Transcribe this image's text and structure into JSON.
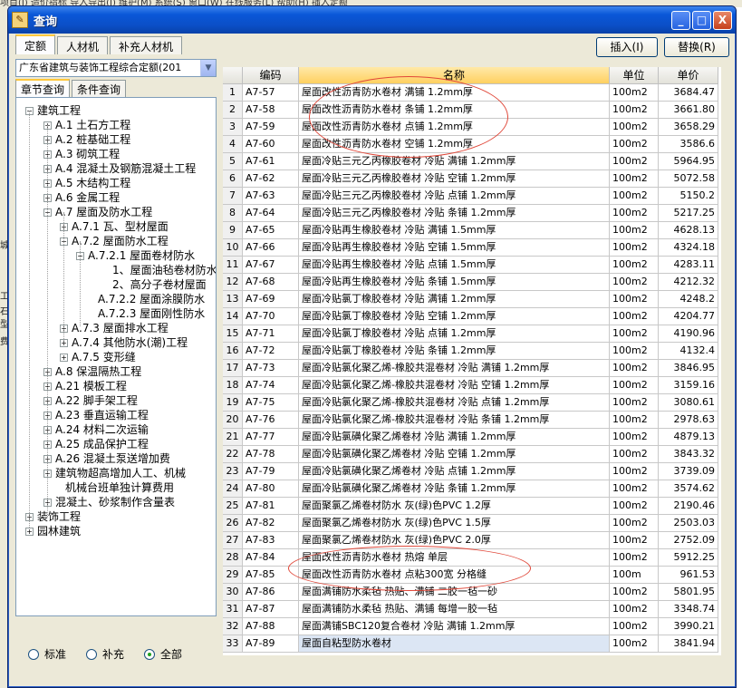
{
  "background": {
    "menu_text": "项目(I)   造价指标   导入导出(I)   维护(M)   系统(S)   窗口(W)   在线服务(L)   帮助(H)   插入定额",
    "left_fragments": [
      "城",
      "工",
      "石",
      "型",
      "费"
    ]
  },
  "window": {
    "title": "查询",
    "minimize": "_",
    "maximize": "□",
    "close": "X"
  },
  "tabs": [
    "定额",
    "人材机",
    "补充人材机"
  ],
  "buttons": {
    "insert": "插入(I)",
    "replace": "替换(R)"
  },
  "left": {
    "combo_value": "广东省建筑与装饰工程综合定额(201",
    "subtabs": [
      "章节查询",
      "条件查询"
    ],
    "tree": [
      {
        "label": "建筑工程",
        "exp": "−"
      },
      {
        "label": "A.1 土石方工程",
        "exp": "+"
      },
      {
        "label": "A.2 桩基础工程",
        "exp": "+"
      },
      {
        "label": "A.3 砌筑工程",
        "exp": "+"
      },
      {
        "label": "A.4 混凝土及钢筋混凝土工程",
        "exp": "+"
      },
      {
        "label": "A.5 木结构工程",
        "exp": "+"
      },
      {
        "label": "A.6 金属工程",
        "exp": "+"
      },
      {
        "label": "A.7 屋面及防水工程",
        "exp": "−"
      },
      {
        "label": "A.7.1 瓦、型材屋面",
        "exp": "+"
      },
      {
        "label": "A.7.2 屋面防水工程",
        "exp": "−"
      },
      {
        "label": "A.7.2.1 屋面卷材防水",
        "exp": "−"
      },
      {
        "label": "1、屋面油毡卷材防水",
        "exp": ""
      },
      {
        "label": "2、高分子卷材屋面",
        "exp": ""
      },
      {
        "label": "A.7.2.2 屋面涂膜防水",
        "exp": ""
      },
      {
        "label": "A.7.2.3 屋面刚性防水",
        "exp": ""
      },
      {
        "label": "A.7.3 屋面排水工程",
        "exp": "+"
      },
      {
        "label": "A.7.4 其他防水(潮)工程",
        "exp": "+"
      },
      {
        "label": "A.7.5 变形缝",
        "exp": "+"
      },
      {
        "label": "A.8 保温隔热工程",
        "exp": "+"
      },
      {
        "label": "A.21 模板工程",
        "exp": "+"
      },
      {
        "label": "A.22 脚手架工程",
        "exp": "+"
      },
      {
        "label": "A.23 垂直运输工程",
        "exp": "+"
      },
      {
        "label": "A.24 材料二次运输",
        "exp": "+"
      },
      {
        "label": "A.25 成品保护工程",
        "exp": "+"
      },
      {
        "label": "A.26 混凝土泵送增加费",
        "exp": "+"
      },
      {
        "label": "建筑物超高增加人工、机械",
        "exp": "+"
      },
      {
        "label": "机械台班单独计算费用",
        "exp": ""
      },
      {
        "label": "混凝土、砂浆制作含量表",
        "exp": "+"
      },
      {
        "label": "装饰工程",
        "exp": "+"
      },
      {
        "label": "园林建筑",
        "exp": "+"
      }
    ],
    "radios": [
      {
        "label": "标准",
        "checked": false
      },
      {
        "label": "补充",
        "checked": false
      },
      {
        "label": "全部",
        "checked": true
      }
    ]
  },
  "grid": {
    "headers": [
      "",
      "编码",
      "名称",
      "单位",
      "单价"
    ],
    "rows": [
      [
        "1",
        "A7-57",
        "屋面改性沥青防水卷材 满铺 1.2mm厚",
        "100m2",
        "3684.47"
      ],
      [
        "2",
        "A7-58",
        "屋面改性沥青防水卷材 条铺 1.2mm厚",
        "100m2",
        "3661.80"
      ],
      [
        "3",
        "A7-59",
        "屋面改性沥青防水卷材 点铺 1.2mm厚",
        "100m2",
        "3658.29"
      ],
      [
        "4",
        "A7-60",
        "屋面改性沥青防水卷材 空铺 1.2mm厚",
        "100m2",
        "3586.6"
      ],
      [
        "5",
        "A7-61",
        "屋面冷贴三元乙丙橡胶卷材 冷贴 满铺 1.2mm厚",
        "100m2",
        "5964.95"
      ],
      [
        "6",
        "A7-62",
        "屋面冷贴三元乙丙橡胶卷材 冷贴 空铺 1.2mm厚",
        "100m2",
        "5072.58"
      ],
      [
        "7",
        "A7-63",
        "屋面冷贴三元乙丙橡胶卷材 冷贴 点铺 1.2mm厚",
        "100m2",
        "5150.2"
      ],
      [
        "8",
        "A7-64",
        "屋面冷贴三元乙丙橡胶卷材 冷贴 条铺 1.2mm厚",
        "100m2",
        "5217.25"
      ],
      [
        "9",
        "A7-65",
        "屋面冷贴再生橡胶卷材 冷贴 满铺 1.5mm厚",
        "100m2",
        "4628.13"
      ],
      [
        "10",
        "A7-66",
        "屋面冷贴再生橡胶卷材 冷贴 空铺 1.5mm厚",
        "100m2",
        "4324.18"
      ],
      [
        "11",
        "A7-67",
        "屋面冷贴再生橡胶卷材 冷贴 点铺 1.5mm厚",
        "100m2",
        "4283.11"
      ],
      [
        "12",
        "A7-68",
        "屋面冷贴再生橡胶卷材 冷贴 条铺 1.5mm厚",
        "100m2",
        "4212.32"
      ],
      [
        "13",
        "A7-69",
        "屋面冷贴氯丁橡胶卷材 冷贴 满铺 1.2mm厚",
        "100m2",
        "4248.2"
      ],
      [
        "14",
        "A7-70",
        "屋面冷贴氯丁橡胶卷材 冷贴 空铺 1.2mm厚",
        "100m2",
        "4204.77"
      ],
      [
        "15",
        "A7-71",
        "屋面冷贴氯丁橡胶卷材 冷贴 点铺 1.2mm厚",
        "100m2",
        "4190.96"
      ],
      [
        "16",
        "A7-72",
        "屋面冷贴氯丁橡胶卷材 冷贴 条铺 1.2mm厚",
        "100m2",
        "4132.4"
      ],
      [
        "17",
        "A7-73",
        "屋面冷贴氯化聚乙烯-橡胶共混卷材 冷贴 满铺 1.2mm厚",
        "100m2",
        "3846.95"
      ],
      [
        "18",
        "A7-74",
        "屋面冷贴氯化聚乙烯-橡胶共混卷材 冷贴 空铺 1.2mm厚",
        "100m2",
        "3159.16"
      ],
      [
        "19",
        "A7-75",
        "屋面冷贴氯化聚乙烯-橡胶共混卷材 冷贴 点铺 1.2mm厚",
        "100m2",
        "3080.61"
      ],
      [
        "20",
        "A7-76",
        "屋面冷贴氯化聚乙烯-橡胶共混卷材 冷贴 条铺 1.2mm厚",
        "100m2",
        "2978.63"
      ],
      [
        "21",
        "A7-77",
        "屋面冷贴氯磺化聚乙烯卷材 冷贴 满铺 1.2mm厚",
        "100m2",
        "4879.13"
      ],
      [
        "22",
        "A7-78",
        "屋面冷贴氯磺化聚乙烯卷材 冷贴 空铺 1.2mm厚",
        "100m2",
        "3843.32"
      ],
      [
        "23",
        "A7-79",
        "屋面冷贴氯磺化聚乙烯卷材 冷贴 点铺 1.2mm厚",
        "100m2",
        "3739.09"
      ],
      [
        "24",
        "A7-80",
        "屋面冷贴氯磺化聚乙烯卷材 冷贴 条铺 1.2mm厚",
        "100m2",
        "3574.62"
      ],
      [
        "25",
        "A7-81",
        "屋面聚氯乙烯卷材防水 灰(绿)色PVC 1.2厚",
        "100m2",
        "2190.46"
      ],
      [
        "26",
        "A7-82",
        "屋面聚氯乙烯卷材防水 灰(绿)色PVC 1.5厚",
        "100m2",
        "2503.03"
      ],
      [
        "27",
        "A7-83",
        "屋面聚氯乙烯卷材防水 灰(绿)色PVC 2.0厚",
        "100m2",
        "2752.09"
      ],
      [
        "28",
        "A7-84",
        "屋面改性沥青防水卷材 热熔 单层",
        "100m2",
        "5912.25"
      ],
      [
        "29",
        "A7-85",
        "屋面改性沥青防水卷材 点粘300宽 分格缝",
        "100m",
        "961.53"
      ],
      [
        "30",
        "A7-86",
        "屋面满铺防水柔毡 热贴、满铺 二胶一毡一砂",
        "100m2",
        "5801.95"
      ],
      [
        "31",
        "A7-87",
        "屋面满铺防水柔毡 热贴、满铺 每增一胶一毡",
        "100m2",
        "3348.74"
      ],
      [
        "32",
        "A7-88",
        "屋面满铺SBC120复合卷材 冷贴 满铺 1.2mm厚",
        "100m2",
        "3990.21"
      ],
      [
        "33",
        "A7-89",
        "屋面自粘型防水卷材",
        "100m2",
        "3841.94"
      ]
    ]
  }
}
